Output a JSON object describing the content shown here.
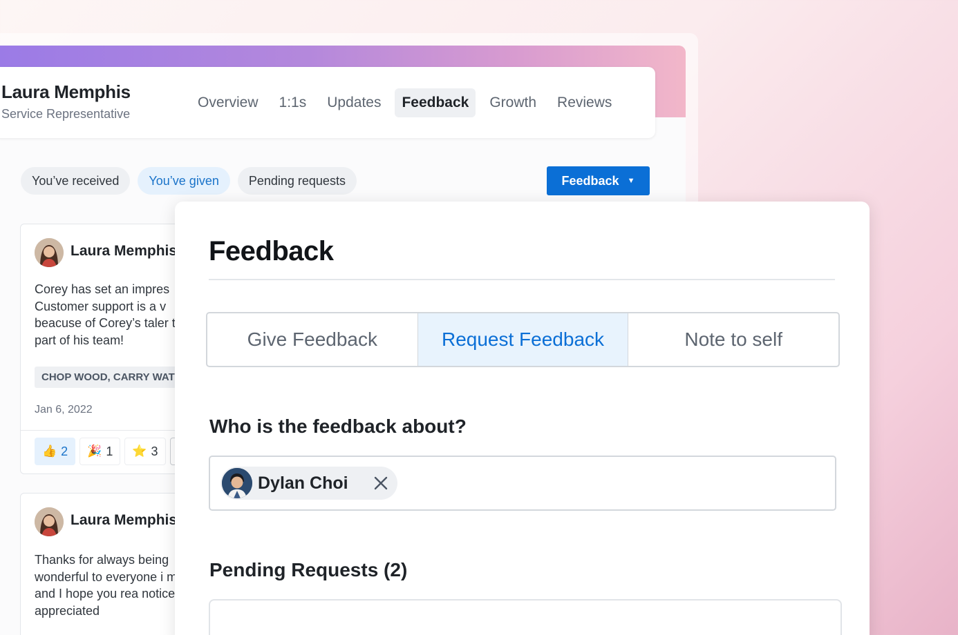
{
  "profile": {
    "name": "Laura Memphis",
    "role": "Service Representative"
  },
  "nav": {
    "tabs": [
      "Overview",
      "1:1s",
      "Updates",
      "Feedback",
      "Growth",
      "Reviews"
    ],
    "active": "Feedback"
  },
  "filters": {
    "chips": [
      "You’ve received",
      "You’ve given",
      "Pending requests"
    ],
    "active": "You’ve given"
  },
  "feedback_button": {
    "label": "Feedback",
    "caret": "▼"
  },
  "cards": [
    {
      "author": "Laura Memphis",
      "text": "Corey has set an impres Customer support is a v beacuse of Corey’s taler to be part of his team!",
      "tag": "CHOP WOOD, CARRY WAT",
      "date": "Jan 6, 2022",
      "reactions": [
        {
          "icon": "thumbs-up-icon",
          "glyph": "👍",
          "count": "2",
          "mine": true
        },
        {
          "icon": "party-popper-icon",
          "glyph": "🎉",
          "count": "1",
          "mine": false
        },
        {
          "icon": "star-icon",
          "glyph": "⭐",
          "count": "3",
          "mine": false
        }
      ]
    },
    {
      "author": "Laura Memphis",
      "text": "Thanks for always being wonderful to everyone i much and I hope you rea noticed and appreciated"
    }
  ],
  "modal": {
    "title": "Feedback",
    "segments": [
      "Give Feedback",
      "Request Feedback",
      "Note to self"
    ],
    "active_segment": "Request Feedback",
    "question": "Who is the feedback about?",
    "selected_person": "Dylan Choi",
    "pending_title": "Pending Requests (2)"
  },
  "colors": {
    "primary": "#0b6fd6",
    "active_chip_bg": "#e5f1fd",
    "active_chip_text": "#1a73c9",
    "header_gradient_start": "#9b7be6",
    "header_gradient_end": "#f2b7c9"
  }
}
